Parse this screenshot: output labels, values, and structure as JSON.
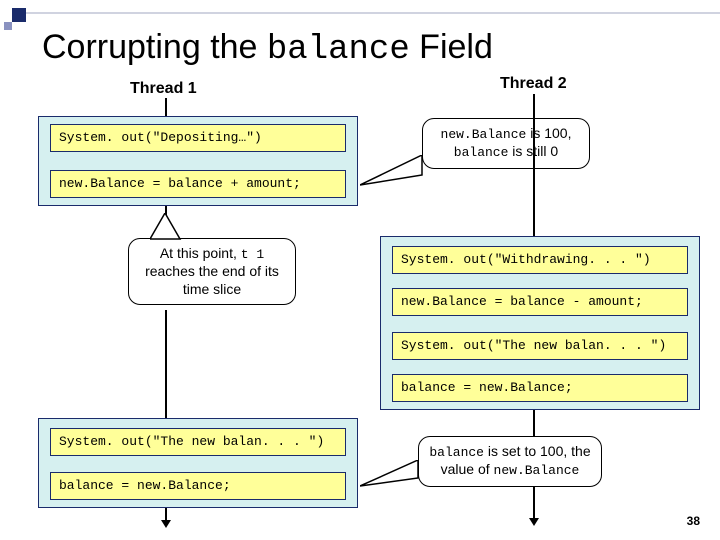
{
  "title_pre": "Corrupting the ",
  "title_code": "balance",
  "title_post": " Field",
  "thread1_label": "Thread 1",
  "thread2_label": "Thread 2",
  "t1": {
    "line1": "System. out(\"Depositing…\")",
    "line2": "new.Balance = balance + amount;",
    "line3": "System. out(\"The new balan. . . \")",
    "line4": "balance = new.Balance;"
  },
  "t2": {
    "line1": "System. out(\"Withdrawing. . . \")",
    "line2": "new.Balance = balance - amount;",
    "line3": "System. out(\"The new balan. . . \")",
    "line4": "balance = new.Balance;"
  },
  "callout1_a": "new.Balance",
  "callout1_b": " is 100, ",
  "callout1_c": "balance",
  "callout1_d": " is still 0",
  "callout2_a": "At this point, ",
  "callout2_b": "t 1",
  "callout2_c": " reaches the end of its time slice",
  "callout3_a": "balance",
  "callout3_b": " is set to 100, the value of ",
  "callout3_c": "new.Balance",
  "slide_number": "38"
}
